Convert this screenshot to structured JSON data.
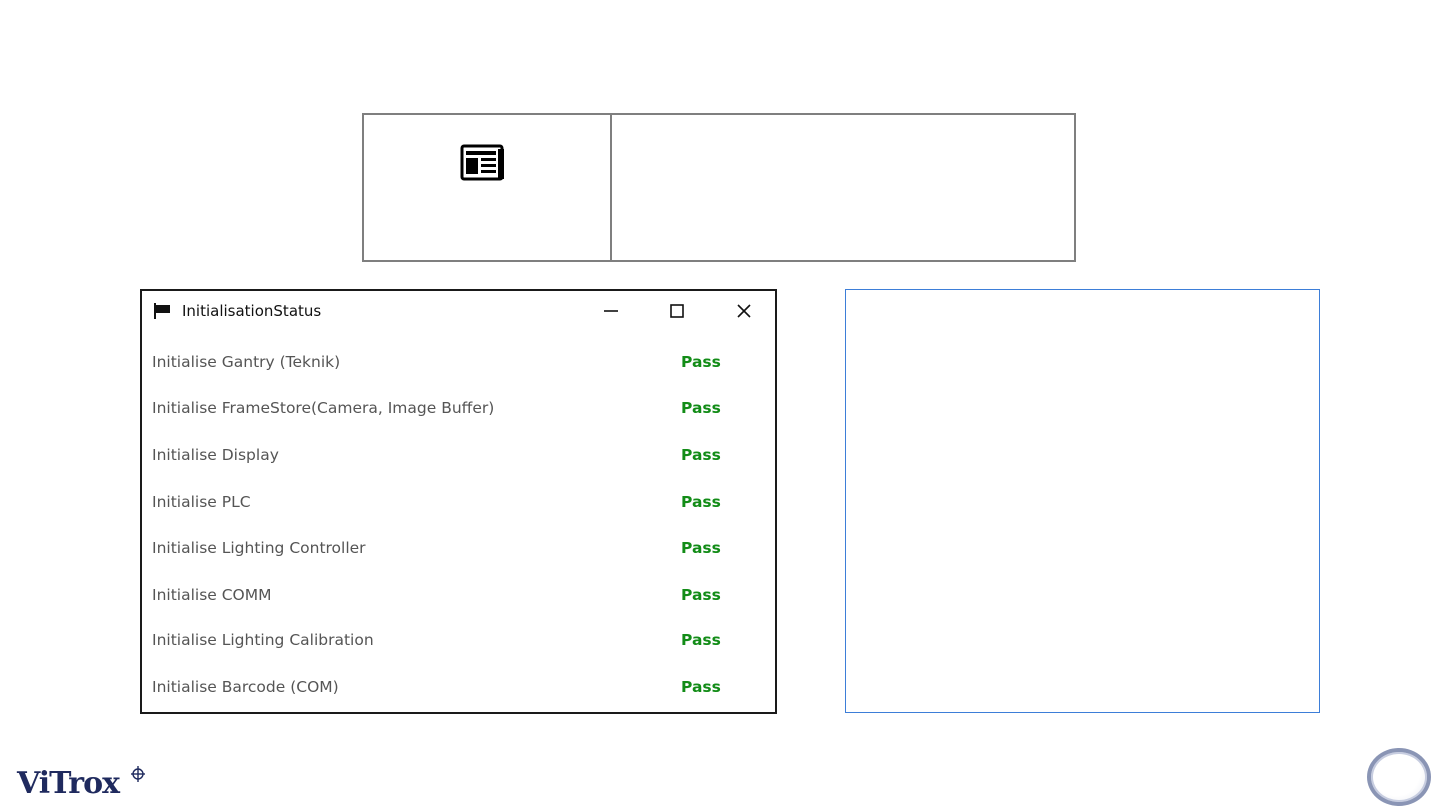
{
  "window": {
    "title": "InitialisationStatus",
    "icon": "flag-icon",
    "controls": [
      "minimize",
      "maximize",
      "close"
    ]
  },
  "status_rows": [
    {
      "label": "Initialise Gantry (Teknik)",
      "status": "Pass"
    },
    {
      "label": "Initialise FrameStore(Camera, Image Buffer)",
      "status": "Pass"
    },
    {
      "label": "Initialise Display",
      "status": "Pass"
    },
    {
      "label": "Initialise PLC",
      "status": "Pass"
    },
    {
      "label": "Initialise Lighting Controller",
      "status": "Pass"
    },
    {
      "label": "Initialise COMM",
      "status": "Pass"
    },
    {
      "label": "Initialise Lighting Calibration",
      "status": "Pass"
    },
    {
      "label": "Initialise Barcode (COM)",
      "status": "Pass"
    }
  ],
  "colors": {
    "pass": "#128c17",
    "label": "#555555",
    "panel_border": "#3d7ed8",
    "logo": "#1f2a5e"
  },
  "top_table": {
    "icon": "news-icon"
  },
  "logo": {
    "text": "ViTrox"
  }
}
